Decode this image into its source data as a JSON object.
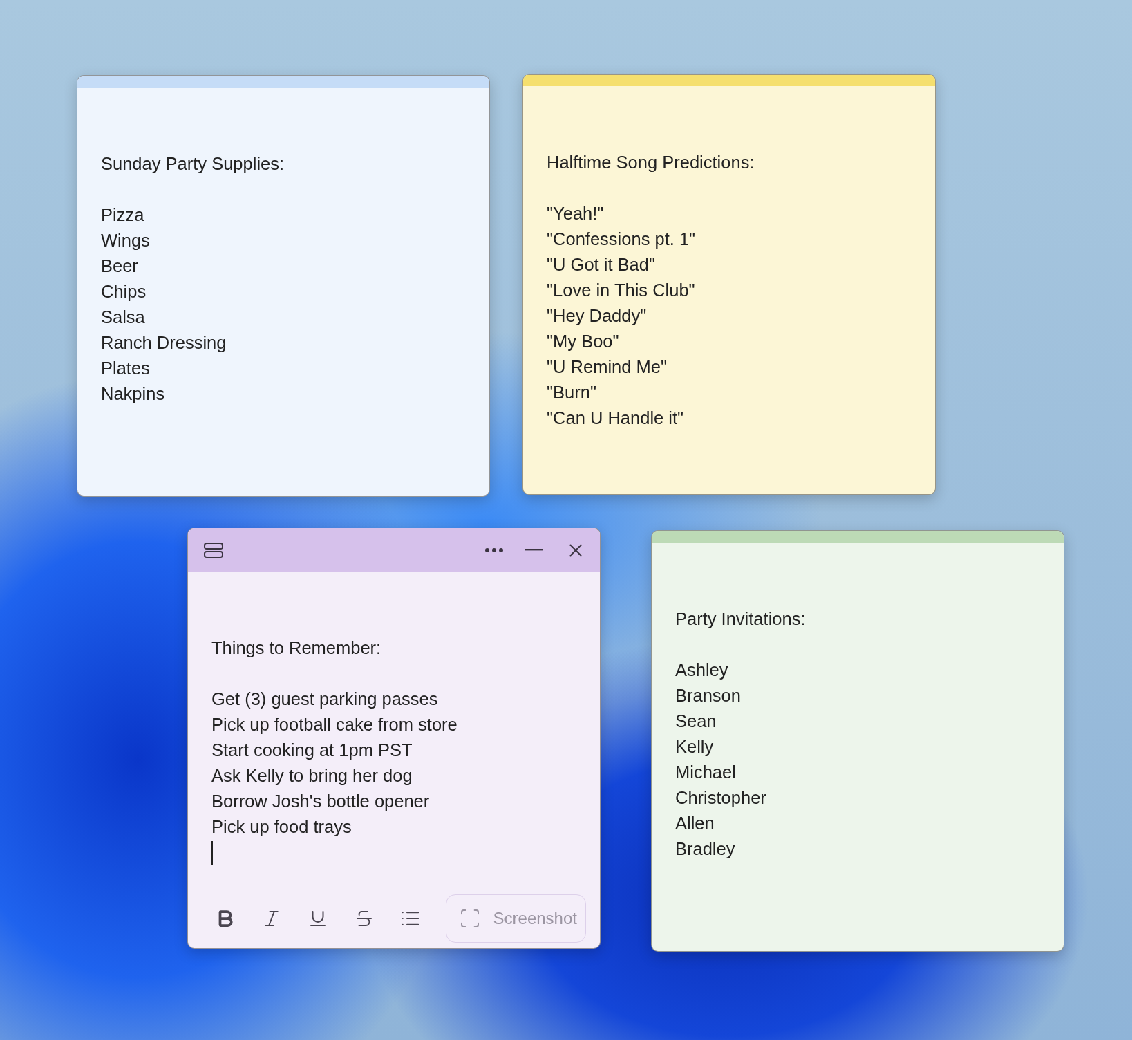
{
  "notes": [
    {
      "color": "#c5dcf7",
      "focused": false,
      "title": "Sunday Party Supplies:",
      "lines": [
        "Pizza",
        "Wings",
        "Beer",
        "Chips",
        "Salsa",
        "Ranch Dressing",
        "Plates",
        "Nakpins"
      ]
    },
    {
      "color": "#f5df6e",
      "focused": false,
      "title": "Halftime Song Predictions:",
      "lines": [
        "\"Yeah!\"",
        "\"Confessions pt. 1\"",
        "\"U Got it Bad\"",
        "\"Love in This Club\"",
        "\"Hey Daddy\"",
        "\"My Boo\"",
        "\"U Remind Me\"",
        "\"Burn\"",
        "\"Can U Handle it\""
      ]
    },
    {
      "color": "#d6c1eb",
      "focused": true,
      "title": "Things to Remember:",
      "lines": [
        "Get (3) guest parking passes",
        "Pick up football cake from store",
        "Start cooking at 1pm PST",
        "Ask Kelly to bring her dog",
        "Borrow Josh's bottle opener",
        "Pick up food trays"
      ],
      "toolbar": {
        "tools": [
          {
            "kind": "bold"
          },
          {
            "kind": "italic"
          },
          {
            "kind": "underline"
          },
          {
            "kind": "strikethrough"
          },
          {
            "kind": "list"
          }
        ],
        "screenshot": {
          "label": "Screenshot",
          "disabled": true
        }
      }
    },
    {
      "color": "#bddab6",
      "focused": false,
      "title": "Party Invitations:",
      "lines": [
        "Ashley",
        "Branson",
        "Sean",
        "Kelly",
        "Michael",
        "Christopher",
        "Allen",
        "Bradley"
      ]
    }
  ]
}
